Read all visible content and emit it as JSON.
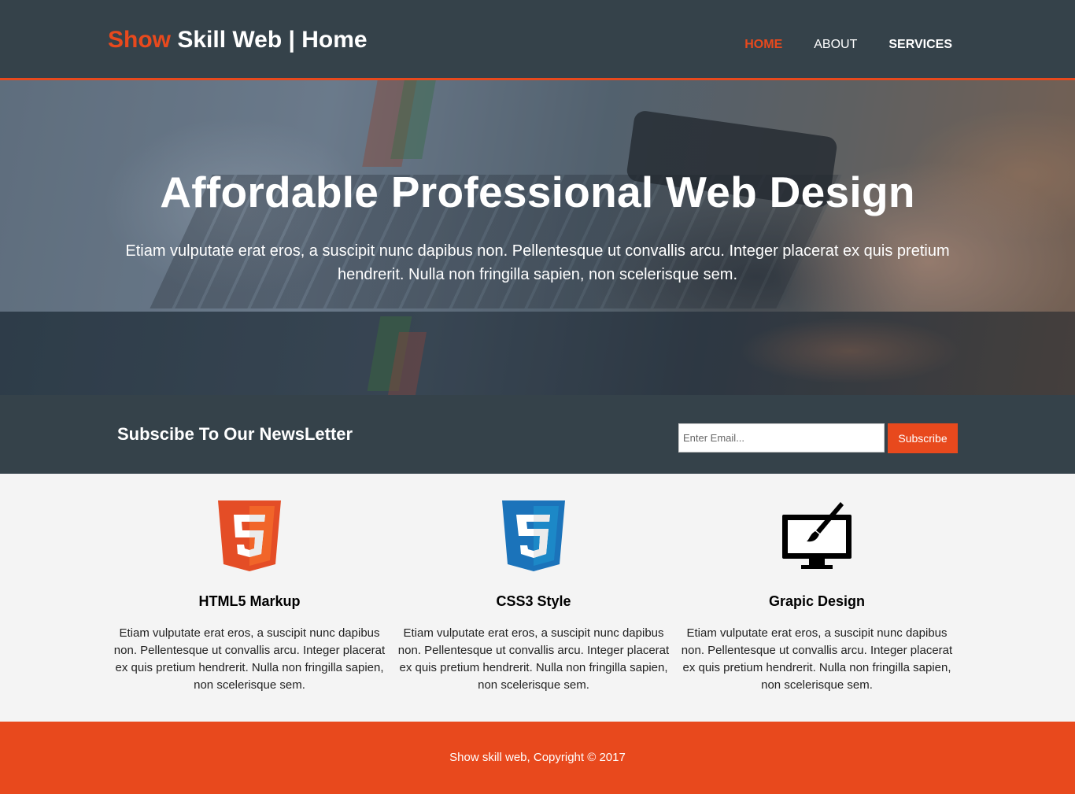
{
  "header": {
    "brand_highlight": "Show",
    "brand_rest": " Skill Web | Home",
    "nav": [
      {
        "label": "HOME",
        "state": "current"
      },
      {
        "label": "ABOUT",
        "state": "normal"
      },
      {
        "label": "SERVICES",
        "state": "normal"
      }
    ]
  },
  "showcase": {
    "title": "Affordable Professional Web Design",
    "text": "Etiam vulputate erat eros, a suscipit nunc dapibus non. Pellentesque ut convallis arcu. Integer placerat ex quis pretium hendrerit. Nulla non fringilla sapien, non scelerisque sem."
  },
  "newsletter": {
    "title": "Subscibe To Our NewsLetter",
    "email_placeholder": "Enter Email...",
    "email_value": "",
    "button_label": "Subscribe"
  },
  "boxes": [
    {
      "icon": "html5-logo-icon",
      "title": "HTML5 Markup",
      "text": "Etiam vulputate erat eros, a suscipit nunc dapibus non. Pellentesque ut convallis arcu. Integer placerat ex quis pretium hendrerit. Nulla non fringilla sapien, non scelerisque sem."
    },
    {
      "icon": "css3-logo-icon",
      "title": "CSS3 Style",
      "text": "Etiam vulputate erat eros, a suscipit nunc dapibus non. Pellentesque ut convallis arcu. Integer placerat ex quis pretium hendrerit. Nulla non fringilla sapien, non scelerisque sem."
    },
    {
      "icon": "monitor-brush-icon",
      "title": "Grapic Design",
      "text": "Etiam vulputate erat eros, a suscipit nunc dapibus non. Pellentesque ut convallis arcu. Integer placerat ex quis pretium hendrerit. Nulla non fringilla sapien, non scelerisque sem."
    }
  ],
  "footer": {
    "text": "Show skill web, Copyright © 2017"
  },
  "colors": {
    "accent": "#e8491d",
    "header_bg": "#35424a",
    "body_bg": "#f4f4f4"
  }
}
